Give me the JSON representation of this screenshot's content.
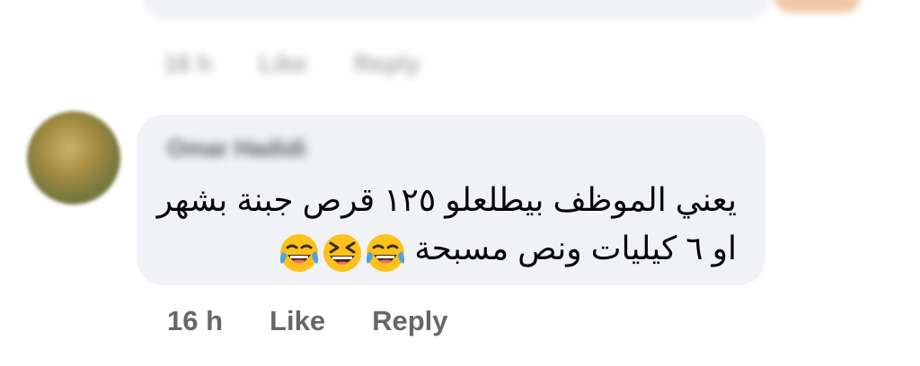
{
  "previous_comment": {
    "actions": {
      "time": "16 h",
      "like": "Like",
      "reply": "Reply"
    }
  },
  "comment": {
    "author": "Omar Hadidi",
    "text_line_1": "يعني الموظف بيطلعلو ١٢٥ قرص جبنة بشهر",
    "text_line_2": "او ٦ كيليات ونص مسبحة",
    "emojis": [
      "face-with-tears-of-joy-icon",
      "grinning-squinting-face-icon",
      "face-with-tears-of-joy-icon"
    ],
    "time": "16 h",
    "like_label": "Like",
    "reply_label": "Reply"
  },
  "colors": {
    "bubble": "#f0f2f5",
    "meta_text": "#65676b",
    "body_text": "#050505",
    "emoji_yellow": "#fcc21b",
    "tear_blue": "#4fa3e0"
  }
}
